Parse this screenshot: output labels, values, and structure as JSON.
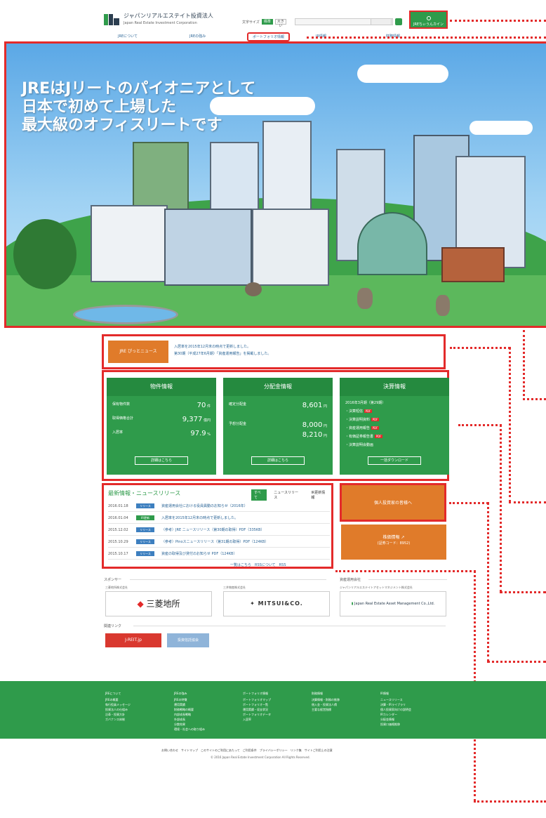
{
  "header": {
    "logo_name": "ジャパンリアルエステイト投資法人",
    "logo_sub": "Japan Real Estate Investment Corporation",
    "font_size_label": "文字サイズ",
    "font_size_options": [
      "標準",
      "大きい"
    ],
    "login_label": "JREちぃうんカイン",
    "nav": [
      "JREについて",
      "JREの強み",
      "ポートフォリオ情報",
      "IR情報",
      "財務情報"
    ]
  },
  "hero": {
    "headline": "JREはJリートのパイオニアとして\n日本で初めて上場した\n最大級のオフィスリートです"
  },
  "pickup": {
    "label": "JRE ぴっとニュース",
    "lines": [
      "入居率を2015年12月末の時点で更新しました。",
      "第30期（平成27年6月期）「資産運用報告」を掲載しました。"
    ]
  },
  "cards": [
    {
      "title": "物件情報",
      "rows": [
        {
          "label": "保有物件数",
          "value": "70",
          "unit": "件"
        },
        {
          "label": "取得価格合計",
          "value": "9,377",
          "unit": "億円"
        },
        {
          "label": "入居率",
          "value": "97.9",
          "unit": "%"
        }
      ],
      "button": "詳細はこちら"
    },
    {
      "title": "分配金情報",
      "rows": [
        {
          "label": "確定分配金",
          "value": "8,601",
          "unit": "円"
        },
        {
          "label": "予想分配金",
          "value": "8,000",
          "unit": "円"
        },
        {
          "label": "",
          "value": "8,210",
          "unit": "円"
        }
      ],
      "button": "詳細はこちら"
    },
    {
      "title": "決算情報",
      "rows": [
        {
          "label": "2016年3月期（第29期）",
          "value": "",
          "unit": ""
        },
        {
          "label": "・決算短信",
          "value": "PDF",
          "unit": ""
        },
        {
          "label": "・決算説明資料",
          "value": "PDF",
          "unit": ""
        },
        {
          "label": "・資産運用報告",
          "value": "PDF",
          "unit": ""
        },
        {
          "label": "・有価証券報告書",
          "value": "PDF",
          "unit": ""
        },
        {
          "label": "・決算説明会動画",
          "value": "",
          "unit": ""
        }
      ],
      "button": "一括ダウンロード"
    }
  ],
  "news": {
    "title": "最新情報・ニュースリリース",
    "tabs": [
      "すべて",
      "ニュースリリース",
      "IR更新情報"
    ],
    "items": [
      {
        "date": "2016.01.18",
        "badge": "リリース",
        "text": "資産運用会社における役員異動のお知らせ（2016年）"
      },
      {
        "date": "2016.01.04",
        "badge": "IR更新",
        "text": "入居率を2015年12月末の時点で更新しました。"
      },
      {
        "date": "2015.12.02",
        "badge": "リリース",
        "text": "（参考）JRE ニュースリリース（第30期の取得）PDF（335KB）"
      },
      {
        "date": "2015.10.29",
        "badge": "リリース",
        "text": "（参考）Pinoスニュースリリース（第31期の取得）PDF（124KB）"
      },
      {
        "date": "2015.10.17",
        "badge": "リリース",
        "text": "資産の取得及び貸付のお知らせ PDF（124KB）"
      }
    ],
    "more": "一覧はこちら　RSSについて　RSS"
  },
  "side_buttons": {
    "kojin": "個人投資家の皆様へ",
    "kabunushi": "株価情報 ↗",
    "kabunushi_sub": "(証券コード：8952)"
  },
  "sponsors": {
    "title": "スポンサー",
    "asset_title": "資産運用会社",
    "items": [
      {
        "caption": "三菱地所株式会社",
        "name": "三菱地所"
      },
      {
        "caption": "三井物産株式会社",
        "name": "MITSUI&CO."
      },
      {
        "caption": "ジャパンリアルエステイトアセットマネジメント株式会社",
        "name": "Japan Real Estate Asset Management Co.,Ltd."
      }
    ]
  },
  "related": {
    "title": "関連リンク",
    "items": [
      "J-REIT.jp",
      "投資信託協会"
    ]
  },
  "footer": {
    "columns": [
      {
        "title": "JREについて",
        "items": "JREの概要\n執行役員メッセージ\n投資法人の仕組み\n沿革・投資方針\nガバナンス体制"
      },
      {
        "title": "JREの強み",
        "items": "JREの特徴\n運用実績\n財務戦略の概要\n内部成長戦略\n外部成長\n分散効果\n環境・社会への取り組み"
      },
      {
        "title": "ポートフォリオ情報",
        "items": "ポートフォリオマップ\nポートフォリオ一覧\n運用実績・収支状況\nポートフォリオデータ\n入居率"
      },
      {
        "title": "財務情報",
        "items": "決算情報・財務の推移\n借入金・投資法人債\n主要な経営指標"
      },
      {
        "title": "IR情報",
        "items": "ニュースリリース\n決算・IRライブラリ\n個人投資家向けの説明会\nIRカレンダー\n分配金情報\n投資口価格推移"
      }
    ],
    "links": "お問い合わせ　サイトマップ　このサイトのご利用にあたって　ご利用条件　プライバシーポリシー　リンク集　サイトご利用上の注意",
    "copyright": "© 2016 Japan Real Estate Investment Corporation All Rights Reserved."
  },
  "colors": {
    "green": "#2f9b4b",
    "orange": "#e07b2a",
    "highlight": "#e32a2a"
  }
}
